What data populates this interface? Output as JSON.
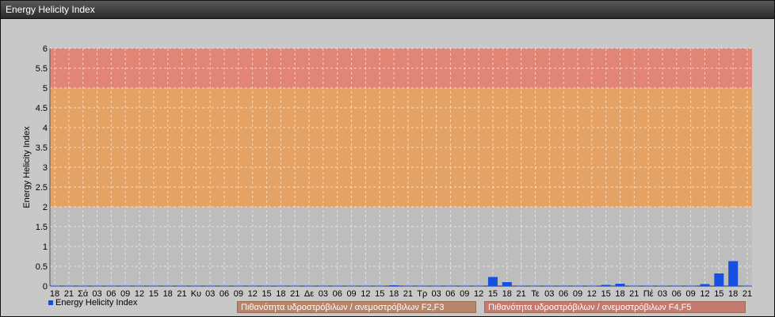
{
  "window": {
    "title": "Energy Helicity Index"
  },
  "colors": {
    "bar": "#1550e0",
    "band_low": "#e8a05a",
    "band_high": "#e47f6e",
    "band_label": "#b6866c",
    "band_label2": "#c47a6e"
  },
  "chart_data": {
    "type": "bar",
    "ylabel": "Energy Helicity Index",
    "ylim": [
      0,
      6
    ],
    "yticks": [
      "0",
      "0.5",
      "1",
      "1.5",
      "2",
      "2.5",
      "3",
      "3.5",
      "4",
      "4.5",
      "5",
      "5.5",
      "6"
    ],
    "categories": [
      "18",
      "21",
      "Σά",
      "03",
      "06",
      "09",
      "12",
      "15",
      "18",
      "21",
      "Κυ",
      "03",
      "06",
      "09",
      "12",
      "15",
      "18",
      "21",
      "Δε",
      "03",
      "06",
      "09",
      "12",
      "15",
      "18",
      "21",
      "Τρ",
      "03",
      "06",
      "09",
      "12",
      "15",
      "18",
      "21",
      "Τε",
      "03",
      "06",
      "09",
      "12",
      "15",
      "18",
      "21",
      "Πέ",
      "03",
      "06",
      "09",
      "12",
      "15",
      "18",
      "21"
    ],
    "series": [
      {
        "name": "Energy Helicity Index",
        "values": [
          0.01,
          0.01,
          0.01,
          0.01,
          0.01,
          0.01,
          0.01,
          0.01,
          0.01,
          0.01,
          0.01,
          0.01,
          0.01,
          0.01,
          0.01,
          0.01,
          0.01,
          0.01,
          0.01,
          0.01,
          0.01,
          0.01,
          0.01,
          0.01,
          0.02,
          0.01,
          0.01,
          0.01,
          0.01,
          0.01,
          0.01,
          0.23,
          0.1,
          0.01,
          0.01,
          0.01,
          0.01,
          0.01,
          0.01,
          0.03,
          0.06,
          0.01,
          0.01,
          0.01,
          0.01,
          0.01,
          0.05,
          0.32,
          0.63,
          0.01
        ]
      }
    ],
    "bands": [
      {
        "from": 2,
        "to": 5,
        "label": "Πιθανότητα υδροστρόβιλων / ανεμοστρόβιλων F2,F3"
      },
      {
        "from": 5,
        "to": 6,
        "label": "Πιθανότητα υδροστρόβιλων / ανεμοστρόβιλων F4,F5"
      }
    ],
    "grid": true,
    "legend": "bottom-left"
  }
}
